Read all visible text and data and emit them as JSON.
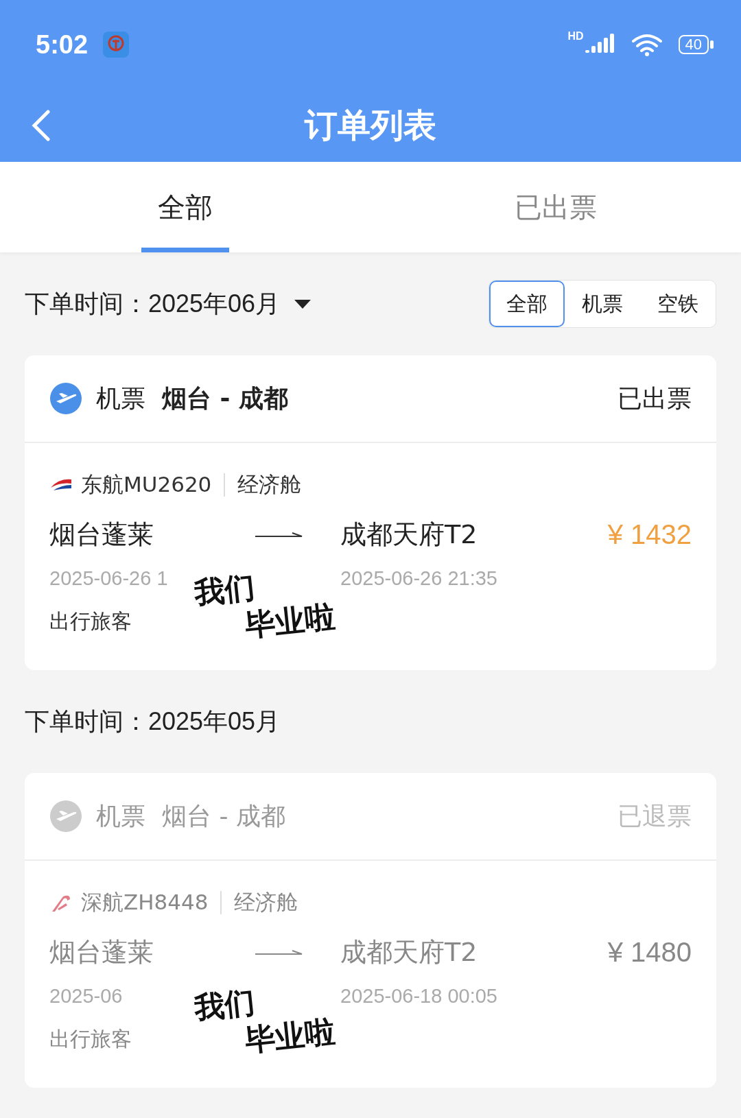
{
  "status_bar": {
    "time": "5:02",
    "battery": "40",
    "network": "HD"
  },
  "header": {
    "title": "订单列表"
  },
  "tabs": [
    {
      "label": "全部",
      "selected": true
    },
    {
      "label": "已出票",
      "selected": false
    }
  ],
  "sections": [
    {
      "label": "下单时间：",
      "month": "2025年06月",
      "has_dropdown": true,
      "filters": [
        {
          "label": "全部",
          "selected": true
        },
        {
          "label": "机票",
          "selected": false
        },
        {
          "label": "空铁",
          "selected": false
        }
      ],
      "orders": [
        {
          "type_label": "机票",
          "route": "烟台 - 成都",
          "status": "已出票",
          "inactive": false,
          "airline": "东航MU2620",
          "kind": "eastern",
          "cabin": "经济舱",
          "from": "烟台蓬莱",
          "from_time": "2025-06-26 1",
          "to": "成都天府T2",
          "to_time": "2025-06-26 21:35",
          "price": "¥ 1432",
          "passenger": "出行旅客",
          "sticker": [
            "我们",
            "毕业啦"
          ]
        }
      ]
    },
    {
      "label": "下单时间：",
      "month": "2025年05月",
      "has_dropdown": false,
      "orders": [
        {
          "type_label": "机票",
          "route": "烟台 - 成都",
          "status": "已退票",
          "inactive": true,
          "airline": "深航ZH8448",
          "kind": "shenzhen",
          "cabin": "经济舱",
          "from": "烟台蓬莱",
          "from_time": "2025-06",
          "to": "成都天府T2",
          "to_time": "2025-06-18 00:05",
          "price": "¥ 1480",
          "passenger": "出行旅客",
          "sticker": [
            "我们",
            "毕业啦"
          ]
        }
      ]
    }
  ]
}
